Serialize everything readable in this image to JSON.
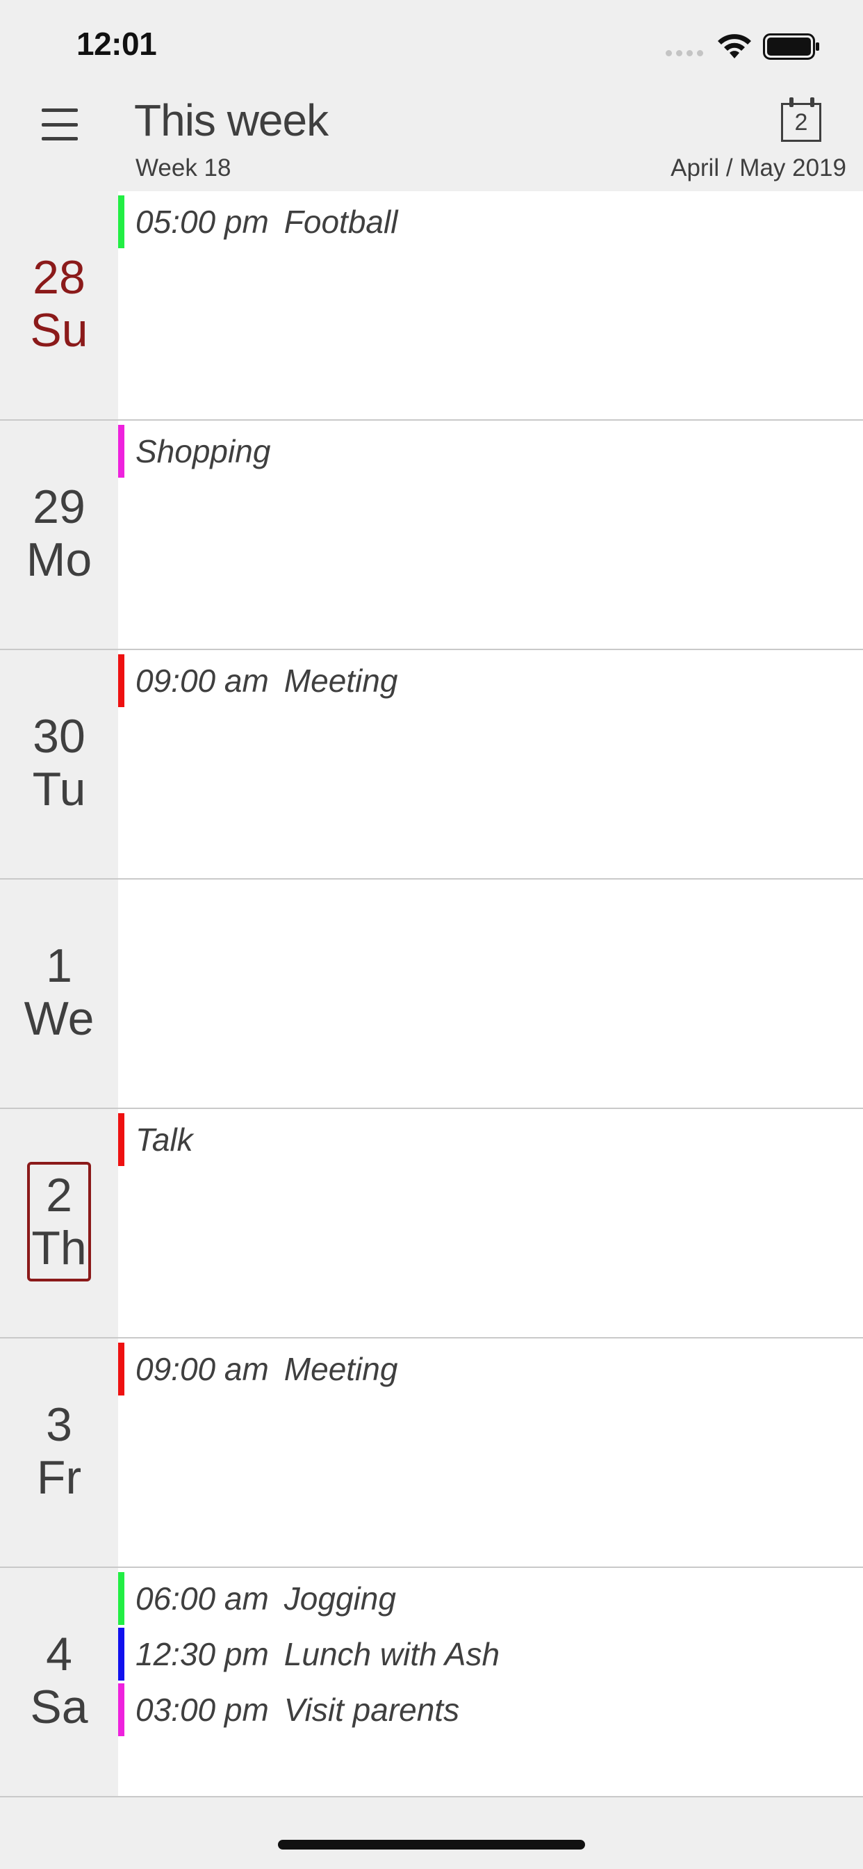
{
  "status_bar": {
    "time": "12:01"
  },
  "header": {
    "title": "This week",
    "week_label": "Week 18",
    "month_label": "April / May 2019",
    "calendar_day": "2"
  },
  "colors": {
    "sunday": "#8b1a1a",
    "today_border": "#8b1a1a",
    "green": "#22ee44",
    "magenta": "#ee22dd",
    "red": "#ee1111",
    "blue": "#1111ee"
  },
  "days": [
    {
      "num": "28",
      "name": "Su",
      "events": [
        {
          "time": "05:00 pm",
          "title": "Football",
          "color": "#22ee44"
        }
      ]
    },
    {
      "num": "29",
      "name": "Mo",
      "events": [
        {
          "time": "",
          "title": "Shopping",
          "color": "#ee22dd"
        }
      ]
    },
    {
      "num": "30",
      "name": "Tu",
      "events": [
        {
          "time": "09:00 am",
          "title": "Meeting",
          "color": "#ee1111"
        }
      ]
    },
    {
      "num": "1",
      "name": "We",
      "events": []
    },
    {
      "num": "2",
      "name": "Th",
      "events": [
        {
          "time": "",
          "title": "Talk",
          "color": "#ee1111"
        }
      ]
    },
    {
      "num": "3",
      "name": "Fr",
      "events": [
        {
          "time": "09:00 am",
          "title": "Meeting",
          "color": "#ee1111"
        }
      ]
    },
    {
      "num": "4",
      "name": "Sa",
      "events": [
        {
          "time": "06:00 am",
          "title": "Jogging",
          "color": "#22ee44"
        },
        {
          "time": "12:30 pm",
          "title": "Lunch with Ash",
          "color": "#1111ee"
        },
        {
          "time": "03:00 pm",
          "title": "Visit parents",
          "color": "#ee22dd"
        }
      ]
    }
  ]
}
